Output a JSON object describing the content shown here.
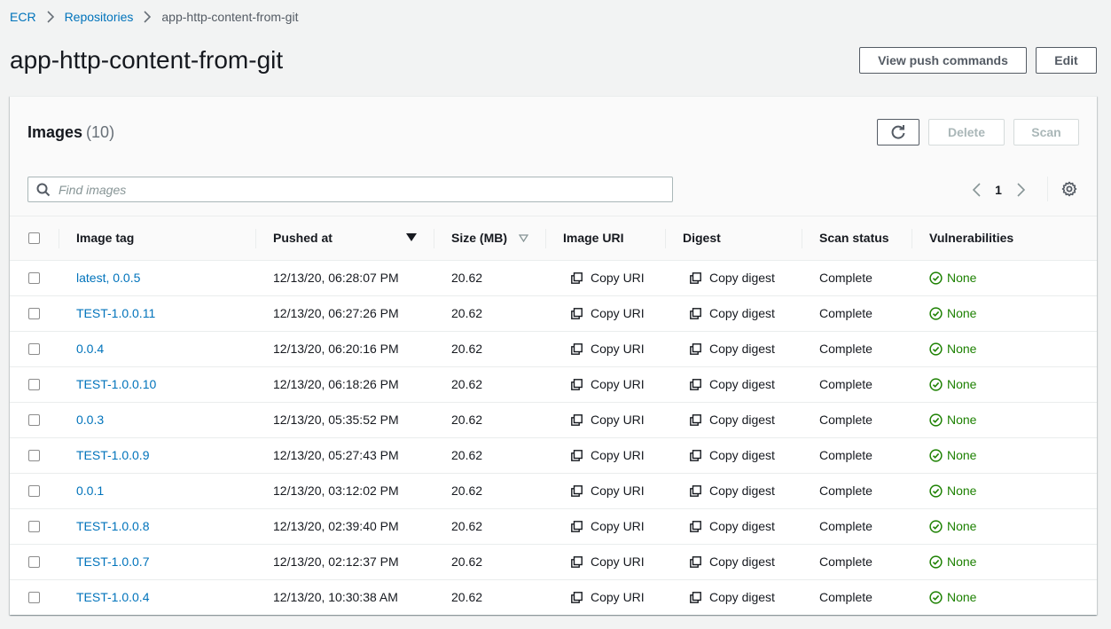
{
  "breadcrumb": {
    "root": "ECR",
    "parent": "Repositories",
    "current": "app-http-content-from-git"
  },
  "page": {
    "title": "app-http-content-from-git"
  },
  "header_buttons": {
    "push_commands": "View push commands",
    "edit": "Edit"
  },
  "panel": {
    "title": "Images",
    "count": "(10)",
    "delete_label": "Delete",
    "scan_label": "Scan",
    "search_placeholder": "Find images",
    "current_page": "1"
  },
  "columns": {
    "image_tag": "Image tag",
    "pushed_at": "Pushed at",
    "size": "Size (MB)",
    "image_uri": "Image URI",
    "digest": "Digest",
    "scan_status": "Scan status",
    "vulnerabilities": "Vulnerabilities"
  },
  "rows": [
    {
      "tag": "latest, 0.0.5",
      "pushed": "12/13/20, 06:28:07 PM",
      "size": "20.62",
      "uri": "Copy URI",
      "digest": "Copy digest",
      "scan": "Complete",
      "vuln": "None"
    },
    {
      "tag": "TEST-1.0.0.11",
      "pushed": "12/13/20, 06:27:26 PM",
      "size": "20.62",
      "uri": "Copy URI",
      "digest": "Copy digest",
      "scan": "Complete",
      "vuln": "None"
    },
    {
      "tag": "0.0.4",
      "pushed": "12/13/20, 06:20:16 PM",
      "size": "20.62",
      "uri": "Copy URI",
      "digest": "Copy digest",
      "scan": "Complete",
      "vuln": "None"
    },
    {
      "tag": "TEST-1.0.0.10",
      "pushed": "12/13/20, 06:18:26 PM",
      "size": "20.62",
      "uri": "Copy URI",
      "digest": "Copy digest",
      "scan": "Complete",
      "vuln": "None"
    },
    {
      "tag": "0.0.3",
      "pushed": "12/13/20, 05:35:52 PM",
      "size": "20.62",
      "uri": "Copy URI",
      "digest": "Copy digest",
      "scan": "Complete",
      "vuln": "None"
    },
    {
      "tag": "TEST-1.0.0.9",
      "pushed": "12/13/20, 05:27:43 PM",
      "size": "20.62",
      "uri": "Copy URI",
      "digest": "Copy digest",
      "scan": "Complete",
      "vuln": "None"
    },
    {
      "tag": "0.0.1",
      "pushed": "12/13/20, 03:12:02 PM",
      "size": "20.62",
      "uri": "Copy URI",
      "digest": "Copy digest",
      "scan": "Complete",
      "vuln": "None"
    },
    {
      "tag": "TEST-1.0.0.8",
      "pushed": "12/13/20, 02:39:40 PM",
      "size": "20.62",
      "uri": "Copy URI",
      "digest": "Copy digest",
      "scan": "Complete",
      "vuln": "None"
    },
    {
      "tag": "TEST-1.0.0.7",
      "pushed": "12/13/20, 02:12:37 PM",
      "size": "20.62",
      "uri": "Copy URI",
      "digest": "Copy digest",
      "scan": "Complete",
      "vuln": "None"
    },
    {
      "tag": "TEST-1.0.0.4",
      "pushed": "12/13/20, 10:30:38 AM",
      "size": "20.62",
      "uri": "Copy URI",
      "digest": "Copy digest",
      "scan": "Complete",
      "vuln": "None"
    }
  ],
  "colors": {
    "link": "#0073bb",
    "success": "#1d8102",
    "text": "#16191f",
    "muted": "#687078",
    "background": "#f2f3f3"
  },
  "icons": {
    "copy": "copy-icon",
    "vuln_ok": "check-circle-icon",
    "refresh": "refresh-icon",
    "settings": "gear-icon",
    "search": "search-icon"
  }
}
